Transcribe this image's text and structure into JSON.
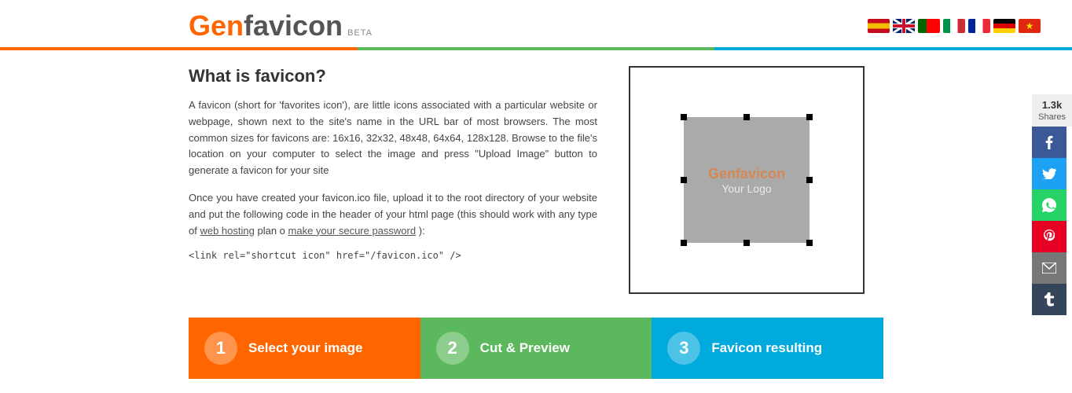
{
  "header": {
    "logo": {
      "gen": "Gen",
      "favicon": "favicon",
      "beta": "BETA"
    },
    "flags": [
      {
        "name": "spain",
        "color": "#c60b1e"
      },
      {
        "name": "uk",
        "color": "#012169"
      },
      {
        "name": "portugal",
        "color": "#006600"
      },
      {
        "name": "italy",
        "color": "#009246"
      },
      {
        "name": "france",
        "color": "#002395"
      },
      {
        "name": "germany",
        "color": "#000"
      },
      {
        "name": "china",
        "color": "#de2910"
      }
    ]
  },
  "main": {
    "title": "What is favicon?",
    "paragraph1": "A favicon (short for 'favorites icon'), are little icons associated with a particular website or webpage, shown next to the site's name in the URL bar of most browsers. The most common sizes for favicons are: 16x16, 32x32, 48x48, 64x64, 128x128. Browse to the file's location on your computer to select the image and press \"Upload Image\" button to generate a favicon for your site",
    "paragraph2": "Once you have created your favicon.ico file, upload it to the root directory of your website and put the following code in the header of your html page (this should work with any type of",
    "link1": "web hosting",
    "link2": "make your secure password",
    "paragraph2_mid": "plan o",
    "paragraph2_end": "):",
    "code": "<link rel=\"shortcut icon\" href=\"/favicon.ico\" />",
    "preview": {
      "logo_text": "Genfavicon",
      "your_logo": "Your Logo"
    }
  },
  "steps": [
    {
      "number": "1",
      "label": "Select your image"
    },
    {
      "number": "2",
      "label": "Cut & Preview"
    },
    {
      "number": "3",
      "label": "Favicon resulting"
    }
  ],
  "social": {
    "count": "1.3k",
    "shares_label": "Shares",
    "buttons": [
      "facebook",
      "twitter",
      "whatsapp",
      "pinterest",
      "email",
      "tumblr"
    ]
  }
}
